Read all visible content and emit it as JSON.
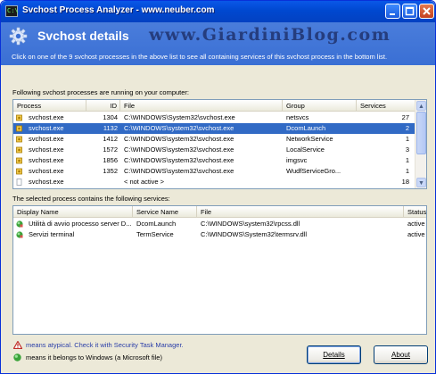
{
  "window": {
    "title": "Svchost Process Analyzer - www.neuber.com",
    "app_icon_text": "C:\\"
  },
  "header": {
    "title": "Svchost details",
    "watermark": "www.GiardiniBlog.com",
    "description": "Click on one of the 9 svchost processes in the above list to see all containing services of this svchost process in the bottom list."
  },
  "processes": {
    "label": "Following svchost processes are running on your computer:",
    "columns": {
      "process": "Process",
      "id": "ID",
      "file": "File",
      "group": "Group",
      "services": "Services"
    },
    "rows": [
      {
        "process": "svchost.exe",
        "id": "1304",
        "file": "C:\\WINDOWS\\System32\\svchost.exe",
        "group": "netsvcs",
        "services": "27",
        "selected": false,
        "active": true
      },
      {
        "process": "svchost.exe",
        "id": "1132",
        "file": "C:\\WINDOWS\\system32\\svchost.exe",
        "group": "DcomLaunch",
        "services": "2",
        "selected": true,
        "active": true
      },
      {
        "process": "svchost.exe",
        "id": "1412",
        "file": "C:\\WINDOWS\\system32\\svchost.exe",
        "group": "NetworkService",
        "services": "1",
        "selected": false,
        "active": true
      },
      {
        "process": "svchost.exe",
        "id": "1572",
        "file": "C:\\WINDOWS\\system32\\svchost.exe",
        "group": "LocalService",
        "services": "3",
        "selected": false,
        "active": true
      },
      {
        "process": "svchost.exe",
        "id": "1856",
        "file": "C:\\WINDOWS\\system32\\svchost.exe",
        "group": "imgsvc",
        "services": "1",
        "selected": false,
        "active": true
      },
      {
        "process": "svchost.exe",
        "id": "1352",
        "file": "C:\\WINDOWS\\system32\\svchost.exe",
        "group": "WudfServiceGro...",
        "services": "1",
        "selected": false,
        "active": true
      },
      {
        "process": "svchost.exe",
        "id": "",
        "file": "< not active >",
        "group": "",
        "services": "18",
        "selected": false,
        "active": false
      }
    ]
  },
  "services": {
    "label": "The selected process contains the following services:",
    "columns": {
      "display": "Display Name",
      "name": "Service Name",
      "file": "File",
      "status": "Status"
    },
    "rows": [
      {
        "display": "Utilità di avvio processo server D...",
        "name": "DcomLaunch",
        "file": "C:\\WINDOWS\\system32\\rpcss.dll",
        "status": "active"
      },
      {
        "display": "Servizi terminal",
        "name": "TermService",
        "file": "C:\\WINDOWS\\System32\\termsrv.dll",
        "status": "active"
      }
    ]
  },
  "legend": {
    "atypical": "means atypical. Check it with Security Task Manager.",
    "windows": "means it belongs to Windows (a Microsoft file)"
  },
  "buttons": {
    "details": "Details",
    "about": "About"
  },
  "colors": {
    "title_bar": "#0048d0",
    "header": "#3a6fd4",
    "selection": "#316ac5",
    "legend_link": "#2a3ea8"
  }
}
